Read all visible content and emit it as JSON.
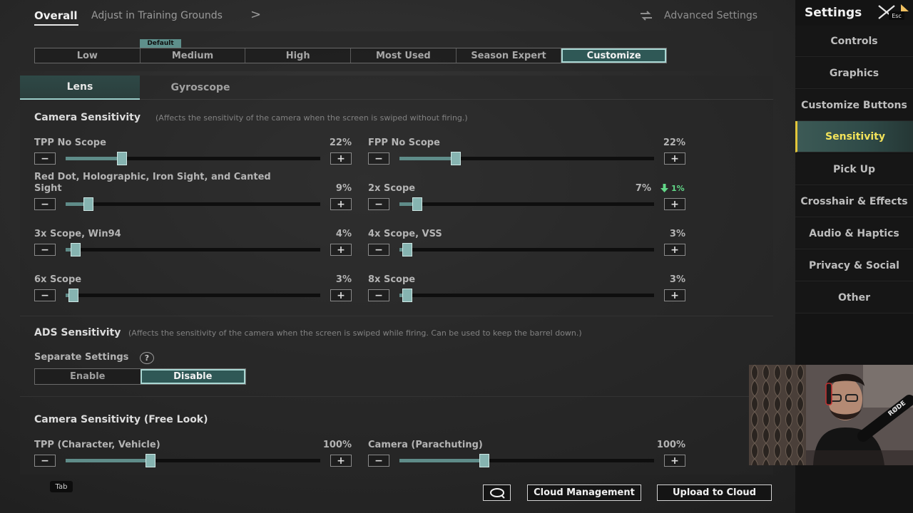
{
  "topbar": {
    "overall": "Overall",
    "breadcrumb": "Adjust in Training Grounds",
    "chevron": ">",
    "advanced": "Advanced Settings"
  },
  "sidebar": {
    "title": "Settings",
    "esc": "Esc",
    "items": [
      {
        "label": "Controls",
        "active": false
      },
      {
        "label": "Graphics",
        "active": false
      },
      {
        "label": "Customize Buttons",
        "active": false
      },
      {
        "label": "Sensitivity",
        "active": true
      },
      {
        "label": "Pick Up",
        "active": false
      },
      {
        "label": "Crosshair & Effects",
        "active": false
      },
      {
        "label": "Audio & Haptics",
        "active": false
      },
      {
        "label": "Privacy & Social",
        "active": false
      },
      {
        "label": "Other",
        "active": false
      }
    ]
  },
  "presets": {
    "default_tag": "Default",
    "items": [
      "Low",
      "Medium",
      "High",
      "Most Used",
      "Season Expert",
      "Customize"
    ],
    "active_index": 5
  },
  "tabs": {
    "lens": "Lens",
    "gyroscope": "Gyroscope"
  },
  "camera": {
    "title": "Camera Sensitivity",
    "note": "(Affects the sensitivity of the camera when the screen is swiped without firing.)",
    "sliders": [
      {
        "label": "TPP No Scope",
        "value_text": "22%",
        "value": 22
      },
      {
        "label": "FPP No Scope",
        "value_text": "22%",
        "value": 22
      },
      {
        "label": "Red Dot, Holographic, Iron Sight, and Canted",
        "label2": "Sight",
        "value_text": "9%",
        "value": 9
      },
      {
        "label": "2x Scope",
        "value_text": "7%",
        "value": 7,
        "delta": "1%"
      },
      {
        "label": "3x Scope, Win94",
        "value_text": "4%",
        "value": 4
      },
      {
        "label": "4x Scope, VSS",
        "value_text": "3%",
        "value": 3
      },
      {
        "label": "6x Scope",
        "value_text": "3%",
        "value": 3
      },
      {
        "label": "8x Scope",
        "value_text": "3%",
        "value": 3
      }
    ]
  },
  "ads": {
    "title": "ADS Sensitivity",
    "note": "(Affects the sensitivity of the camera when the screen is swiped while firing. Can be used to keep the barrel down.)",
    "separate_label": "Separate Settings",
    "help": "?",
    "enable": "Enable",
    "disable": "Disable",
    "active": "disable"
  },
  "freelook": {
    "title": "Camera Sensitivity (Free Look)",
    "sliders": [
      {
        "label": "TPP (Character, Vehicle)",
        "value_text": "100%",
        "value": 100
      },
      {
        "label": "Camera (Parachuting)",
        "value_text": "100%",
        "value": 100
      }
    ]
  },
  "controls": {
    "minus": "−",
    "plus": "+"
  },
  "bottom": {
    "tab_key": "Tab",
    "cloud_management": "Cloud Management",
    "upload": "Upload to Cloud"
  },
  "webcam": {
    "mic_brand": "RØDE"
  },
  "colors": {
    "accent": "#2f5856",
    "accent_border": "#a9d7d3",
    "sidebar_active_text": "#f3e35a",
    "delta_green": "#62d888"
  }
}
